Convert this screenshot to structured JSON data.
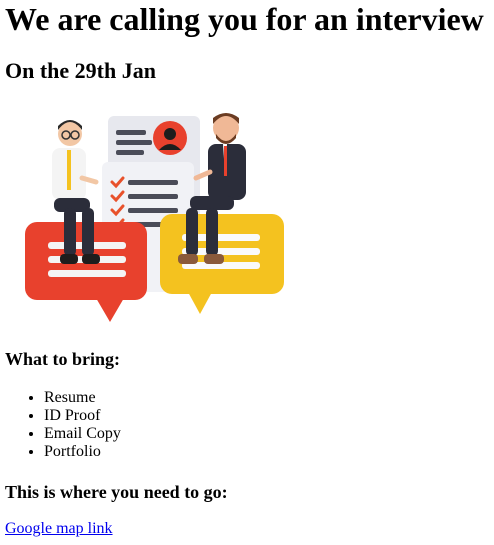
{
  "heading": "We are calling you for an interview",
  "date_heading": "On the 29th Jan",
  "illustration": {
    "icon": "interview-illustration",
    "colors": {
      "red_bubble": "#e8412d",
      "yellow_bubble": "#f4c21f",
      "suit": "#2b2d3a",
      "checkmarks": "#e8512b"
    }
  },
  "bring": {
    "title": "What to bring:",
    "items": [
      "Resume",
      "ID Proof",
      "Email Copy",
      "Portfolio"
    ]
  },
  "location": {
    "title": "This is where you need to go:",
    "link_text": "Google map link"
  },
  "link_color": "#0000ee"
}
